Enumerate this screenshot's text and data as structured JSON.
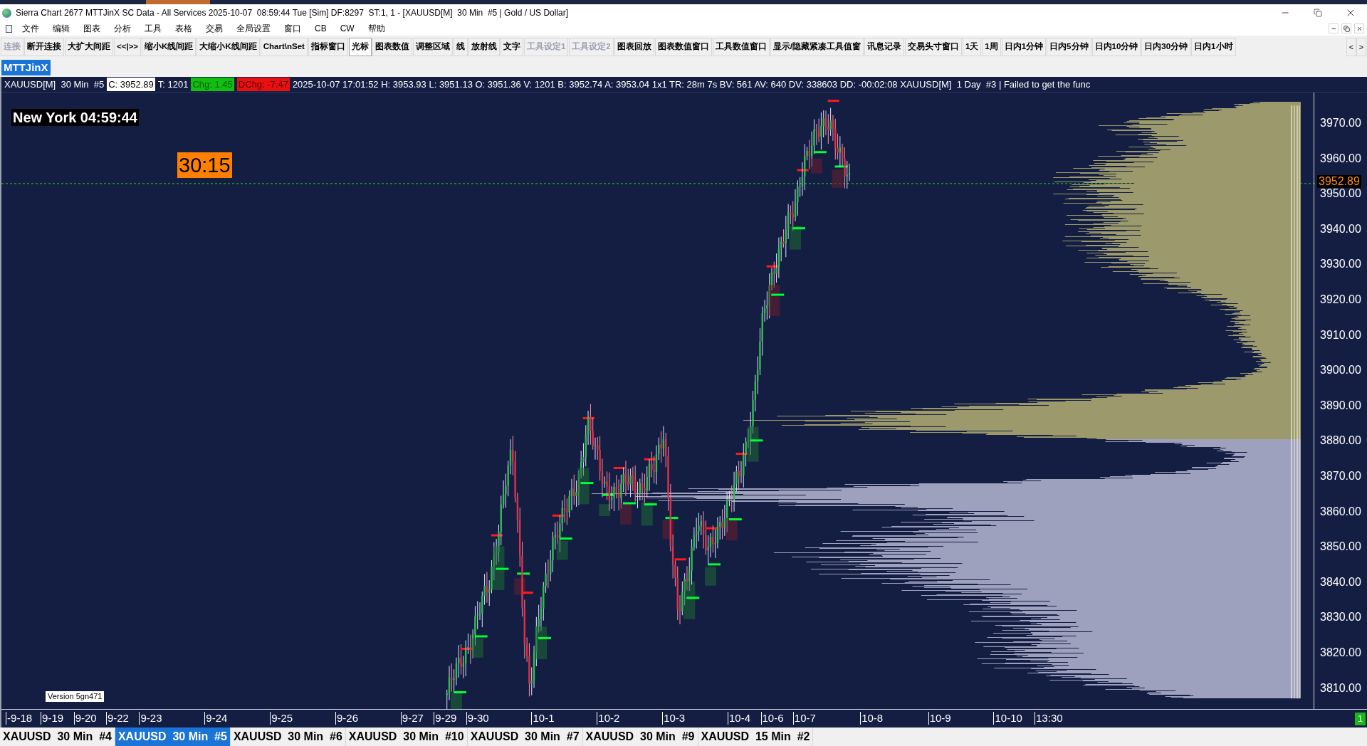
{
  "window": {
    "title": "Sierra Chart 2677 MTTJinX SC Data - All Services 2025-10-07  08:59:44 Tue [Sim] DF:8297  ST:1, 1 - [XAUUSD[M]  30 Min  #5 | Gold / US Dollar]"
  },
  "menu": [
    "文件",
    "编辑",
    "图表",
    "分析",
    "工具",
    "表格",
    "交易",
    "全局设置",
    "窗口",
    "CB",
    "CW",
    "帮助"
  ],
  "toolbar": [
    {
      "label": "连接",
      "disabled": true,
      "selected": false
    },
    {
      "label": "断开连接",
      "disabled": false,
      "selected": false
    },
    {
      "label": "大扩大间距",
      "disabled": false,
      "selected": false
    },
    {
      "label": "<<|>>",
      "disabled": false,
      "selected": false
    },
    {
      "label": "缩小K线间距",
      "disabled": false,
      "selected": false
    },
    {
      "label": "大缩小K线间距",
      "disabled": false,
      "selected": false
    },
    {
      "label": "Chart\\nSet",
      "disabled": false,
      "selected": false
    },
    {
      "label": "指标窗口",
      "disabled": false,
      "selected": false
    },
    {
      "label": "光标",
      "disabled": false,
      "selected": true
    },
    {
      "label": "图表数值",
      "disabled": false,
      "selected": false
    },
    {
      "label": "调整区域",
      "disabled": false,
      "selected": false
    },
    {
      "label": "线",
      "disabled": false,
      "selected": false
    },
    {
      "label": "放射线",
      "disabled": false,
      "selected": false
    },
    {
      "label": "文字",
      "disabled": false,
      "selected": false
    },
    {
      "label": "工具设定1",
      "disabled": true,
      "selected": false
    },
    {
      "label": "工具设定2",
      "disabled": true,
      "selected": false
    },
    {
      "label": "图表回放",
      "disabled": false,
      "selected": false
    },
    {
      "label": "图表数值窗口",
      "disabled": false,
      "selected": false
    },
    {
      "label": "工具数值窗口",
      "disabled": false,
      "selected": false
    },
    {
      "label": "显示/隐藏紧凑工具值窗",
      "disabled": false,
      "selected": false
    },
    {
      "label": "讯息记录",
      "disabled": false,
      "selected": false
    },
    {
      "label": "交易头寸窗口",
      "disabled": false,
      "selected": false
    },
    {
      "label": "1天",
      "disabled": false,
      "selected": false
    },
    {
      "label": "1周",
      "disabled": false,
      "selected": false
    },
    {
      "label": "日内1分钟",
      "disabled": false,
      "selected": false
    },
    {
      "label": "日内5分钟",
      "disabled": false,
      "selected": false
    },
    {
      "label": "日内10分钟",
      "disabled": false,
      "selected": false
    },
    {
      "label": "日内30分钟",
      "disabled": false,
      "selected": false
    },
    {
      "label": "日内1小时",
      "disabled": false,
      "selected": false
    }
  ],
  "toolbar_scroll": [
    "<",
    ">"
  ],
  "chartbook_tab": "MTTJinX",
  "info_line": [
    {
      "kind": "plain",
      "text": "XAUUSD[M]  30 Min  #5"
    },
    {
      "kind": "boxed",
      "text": "C: 3952.89"
    },
    {
      "kind": "plain",
      "text": "T: 1201"
    },
    {
      "kind": "gain",
      "text": "Chg: 1.45"
    },
    {
      "kind": "loss",
      "text": "DChg: -7.47"
    },
    {
      "kind": "plain",
      "text": "2025-10-07 17:01:52 H: 3953.93 L: 3951.13 O: 3951.36 V: 1201 B: 3952.74 A: 3953.04 1x1 TR: 28m 7s BV: 561 AV: 640 DV: 338603 DD: -00:02:08 XAUUSD[M]  1 Day  #3 | Failed to get the func"
    }
  ],
  "chart": {
    "clock": "New York 04:59:44",
    "bar_timer": "30:15",
    "version": "Version 5gn471",
    "current_price": "3952.89",
    "price_labels": [
      "3970.00",
      "3960.00",
      "3950.00",
      "3940.00",
      "3930.00",
      "3920.00",
      "3910.00",
      "3900.00",
      "3890.00",
      "3880.00",
      "3870.00",
      "3860.00",
      "3850.00",
      "3840.00",
      "3830.00",
      "3820.00",
      "3810.00"
    ],
    "date_labels": [
      "-9-18",
      "9-19",
      "9-20",
      "9-22",
      "9-23",
      "9-24",
      "9-25",
      "9-26",
      "9-27",
      "9-29",
      "9-30",
      "10-1",
      "10-2",
      "10-3",
      "10-4",
      "10-6",
      "10-7",
      "10-8",
      "10-9",
      "10-10",
      "13:30"
    ],
    "corner_badge": "1"
  },
  "chart_tabs": [
    {
      "label": "XAUUSD  30 Min  #4",
      "selected": false
    },
    {
      "label": "XAUUSD  30 Min  #5",
      "selected": true
    },
    {
      "label": "XAUUSD  30 Min  #6",
      "selected": false
    },
    {
      "label": "XAUUSD  30 Min  #10",
      "selected": false
    },
    {
      "label": "XAUUSD  30 Min  #7",
      "selected": false
    },
    {
      "label": "XAUUSD  30 Min  #9",
      "selected": false
    },
    {
      "label": "XAUUSD  15 Min  #2",
      "selected": false
    }
  ]
}
